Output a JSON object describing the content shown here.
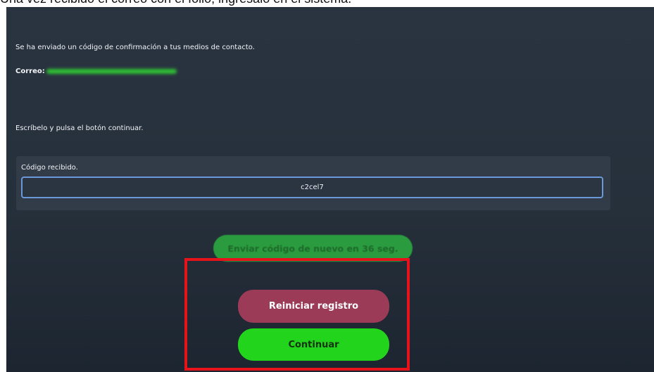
{
  "caption": "Una vez recibido el correo con el folio, ingrésalo en el sistema.",
  "confirmation_message": "Se ha enviado un código de confirmación a tus medios de contacto.",
  "email": {
    "label": "Correo:"
  },
  "instruction": "Escríbelo y pulsa el botón continuar.",
  "code_field": {
    "label": "Código recibido.",
    "value": "c2cel7"
  },
  "resend_button": {
    "label": "Enviar código de nuevo en 36 seg."
  },
  "reset_button": {
    "label": "Reiniciar registro"
  },
  "continue_button": {
    "label": "Continuar"
  },
  "colors": {
    "background": "#26303b",
    "continue": "#22d41b",
    "reset": "#9b3b58",
    "resend": "#2a9b3e",
    "highlight": "#e8121a",
    "input_border": "#6a98d8"
  }
}
